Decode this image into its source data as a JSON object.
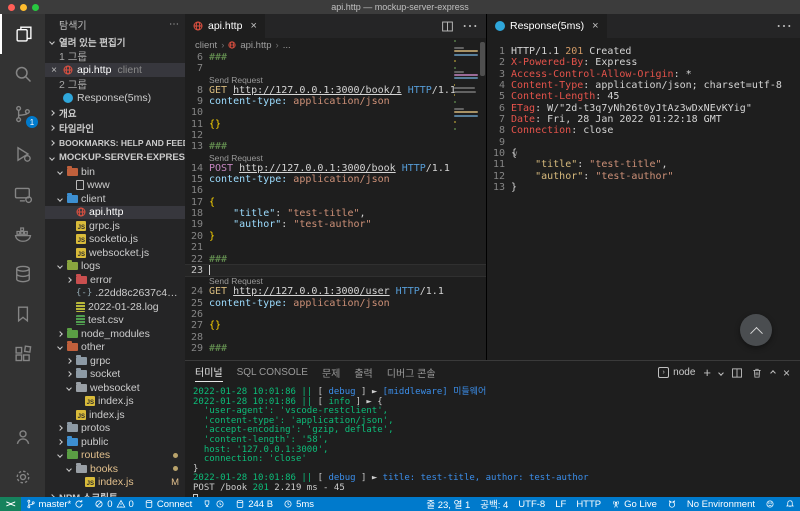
{
  "colors": {
    "accent": "#007acc",
    "remote_green": "#16825d",
    "titlebar": "#3c3c3c",
    "activity_bar": "#333333",
    "sidebar": "#252526",
    "editor_bg": "#1e1e1e",
    "git_modified": "#e2c08d",
    "http_icon": "#e25141",
    "response_icon": "#2fa7db"
  },
  "window": {
    "title": "api.http — mockup-server-express"
  },
  "activity_bar": {
    "scm_badge": "1"
  },
  "sidebar": {
    "title": "탐색기",
    "more": "⋯",
    "open_editors": "열려 있는 편집기",
    "group1": "1 그룹",
    "group2": "2 그룹",
    "editor1": "api.http",
    "editor1_detail": "client",
    "editor2": "Response(5ms)",
    "sections": {
      "outline": "개요",
      "timeline": "타임라인",
      "bookmarks": "BOOKMARKS: HELP AND FEEDBACK"
    },
    "project": "MOCKUP-SERVER-EXPRESS",
    "npm_scripts": "NPM 스크립트",
    "tree": [
      {
        "label": "bin",
        "indent": 1,
        "chev": "d",
        "icon": "folder",
        "color": "#c0603c"
      },
      {
        "label": "www",
        "indent": 2,
        "icon": "file"
      },
      {
        "label": "client",
        "indent": 1,
        "chev": "d",
        "icon": "folder",
        "color": "#3d8fd1"
      },
      {
        "label": "api.http",
        "indent": 2,
        "icon": "globe",
        "selected": true
      },
      {
        "label": "grpc.js",
        "indent": 2,
        "icon": "js"
      },
      {
        "label": "socketio.js",
        "indent": 2,
        "icon": "js"
      },
      {
        "label": "websocket.js",
        "indent": 2,
        "icon": "js"
      },
      {
        "label": "logs",
        "indent": 1,
        "chev": "d",
        "icon": "folder",
        "color": "#8aa53f"
      },
      {
        "label": "error",
        "indent": 2,
        "chev": "r",
        "icon": "folder",
        "color": "#c94f4f"
      },
      {
        "label": ".22dd8c2637c48183c5bb89...",
        "indent": 2,
        "icon": "json"
      },
      {
        "label": "2022-01-28.log",
        "indent": 2,
        "icon": "log"
      },
      {
        "label": "test.csv",
        "indent": 2,
        "icon": "csv"
      },
      {
        "label": "node_modules",
        "indent": 1,
        "chev": "r",
        "icon": "folder",
        "color": "#5a9e44"
      },
      {
        "label": "other",
        "indent": 1,
        "chev": "d",
        "icon": "folder",
        "color": "#c0603c"
      },
      {
        "label": "grpc",
        "indent": 2,
        "chev": "r",
        "icon": "folder",
        "color": "#8d9aa5"
      },
      {
        "label": "socket",
        "indent": 2,
        "chev": "r",
        "icon": "folder",
        "color": "#8d9aa5"
      },
      {
        "label": "websocket",
        "indent": 2,
        "chev": "d",
        "icon": "folder",
        "color": "#9aa0a6"
      },
      {
        "label": "index.js",
        "indent": 3,
        "icon": "js"
      },
      {
        "label": "index.js",
        "indent": 2,
        "icon": "js"
      },
      {
        "label": "protos",
        "indent": 1,
        "chev": "r",
        "icon": "folder",
        "color": "#8d9aa5"
      },
      {
        "label": "public",
        "indent": 1,
        "chev": "r",
        "icon": "folder",
        "color": "#3d8fd1"
      },
      {
        "label": "routes",
        "indent": 1,
        "chev": "d",
        "icon": "folder",
        "color": "#5a9e44",
        "modified": true,
        "badge": "dot"
      },
      {
        "label": "books",
        "indent": 2,
        "chev": "d",
        "icon": "folder",
        "color": "#9aa0a6",
        "modified": true,
        "badge": "dot"
      },
      {
        "label": "index.js",
        "indent": 3,
        "icon": "js",
        "modified": true,
        "badge": "M"
      }
    ]
  },
  "editor": {
    "tab": "api.http",
    "breadcrumb": {
      "a": "client",
      "b": "api.http",
      "c": "..."
    },
    "codelens": "Send Request",
    "lines": [
      {
        "n": "6",
        "parts": [
          [
            "###",
            "cmt"
          ]
        ]
      },
      {
        "n": "7"
      },
      {
        "lens": true
      },
      {
        "n": "8",
        "parts": [
          [
            "GET ",
            "get"
          ],
          [
            "http://127.0.0.1:3000/book/1",
            "url"
          ],
          [
            " ",
            ""
          ],
          [
            "HTTP",
            "kw"
          ],
          [
            "/1.1",
            ""
          ]
        ]
      },
      {
        "n": "9",
        "parts": [
          [
            "content-type: ",
            "key"
          ],
          [
            "application/json",
            "val"
          ]
        ]
      },
      {
        "n": "10"
      },
      {
        "n": "11",
        "parts": [
          [
            "{}",
            "br"
          ]
        ]
      },
      {
        "n": "12"
      },
      {
        "n": "13",
        "parts": [
          [
            "###",
            "cmt"
          ]
        ]
      },
      {
        "lens": true
      },
      {
        "n": "14",
        "parts": [
          [
            "POST ",
            "post"
          ],
          [
            "http://127.0.0.1:3000/book",
            "url"
          ],
          [
            " ",
            ""
          ],
          [
            "HTTP",
            "kw"
          ],
          [
            "/1.1",
            ""
          ]
        ]
      },
      {
        "n": "15",
        "parts": [
          [
            "content-type: ",
            "key"
          ],
          [
            "application/json",
            "val"
          ]
        ]
      },
      {
        "n": "16"
      },
      {
        "n": "17",
        "parts": [
          [
            "{",
            "br"
          ]
        ]
      },
      {
        "n": "18",
        "parts": [
          [
            "    ",
            ""
          ],
          [
            "\"title\"",
            "key"
          ],
          [
            ": ",
            ""
          ],
          [
            "\"test-title\"",
            "val"
          ],
          [
            ",",
            ""
          ]
        ]
      },
      {
        "n": "19",
        "parts": [
          [
            "    ",
            ""
          ],
          [
            "\"author\"",
            "key"
          ],
          [
            ": ",
            ""
          ],
          [
            "\"test-author\"",
            "val"
          ]
        ]
      },
      {
        "n": "20",
        "parts": [
          [
            "}",
            "br"
          ]
        ]
      },
      {
        "n": "21"
      },
      {
        "n": "22",
        "parts": [
          [
            "###",
            "cmt"
          ]
        ]
      },
      {
        "n": "23",
        "cursor": true,
        "current": true
      },
      {
        "lens": true
      },
      {
        "n": "24",
        "parts": [
          [
            "GET ",
            "get"
          ],
          [
            "http://127.0.0.1:3000/user",
            "url"
          ],
          [
            " ",
            ""
          ],
          [
            "HTTP",
            "kw"
          ],
          [
            "/1.1",
            ""
          ]
        ]
      },
      {
        "n": "25",
        "parts": [
          [
            "content-type: ",
            "key"
          ],
          [
            "application/json",
            "val"
          ]
        ]
      },
      {
        "n": "26"
      },
      {
        "n": "27",
        "parts": [
          [
            "{}",
            "br"
          ]
        ]
      },
      {
        "n": "28"
      },
      {
        "n": "29",
        "parts": [
          [
            "###",
            "cmt"
          ]
        ]
      }
    ]
  },
  "response": {
    "tab": "Response(5ms)",
    "more": "⋯",
    "lines": [
      {
        "n": "1",
        "parts": [
          [
            "HTTP/1.1 ",
            ""
          ],
          [
            "201",
            "num"
          ],
          [
            " Created",
            ""
          ]
        ]
      },
      {
        "n": "2",
        "parts": [
          [
            "X-Powered-By",
            "hdr"
          ],
          [
            ": ",
            ""
          ],
          [
            "Express",
            ""
          ]
        ]
      },
      {
        "n": "3",
        "parts": [
          [
            "Access-Control-Allow-Origin",
            "hdr"
          ],
          [
            ": ",
            ""
          ],
          [
            "*",
            ""
          ]
        ]
      },
      {
        "n": "4",
        "parts": [
          [
            "Content-Type",
            "hdr"
          ],
          [
            ": ",
            ""
          ],
          [
            "application/json; charset=utf-8",
            ""
          ]
        ]
      },
      {
        "n": "5",
        "parts": [
          [
            "Content-Length",
            "hdr"
          ],
          [
            ": ",
            ""
          ],
          [
            "45",
            ""
          ]
        ]
      },
      {
        "n": "6",
        "parts": [
          [
            "ETag",
            "hdr"
          ],
          [
            ": ",
            ""
          ],
          [
            "W/\"2d-t3q7yNh26t0yJtAz3wDxNEvKYig\"",
            ""
          ]
        ]
      },
      {
        "n": "7",
        "parts": [
          [
            "Date",
            "hdr"
          ],
          [
            ": ",
            ""
          ],
          [
            "Fri, 28 Jan 2022 01:22:18 GMT",
            ""
          ]
        ]
      },
      {
        "n": "8",
        "parts": [
          [
            "Connection",
            "hdr"
          ],
          [
            ": ",
            ""
          ],
          [
            "close",
            ""
          ]
        ]
      },
      {
        "n": "9"
      },
      {
        "n": "10",
        "fold": true,
        "parts": [
          [
            "{",
            ""
          ]
        ]
      },
      {
        "n": "11",
        "parts": [
          [
            "    ",
            ""
          ],
          [
            "\"title\"",
            "rkey"
          ],
          [
            ": ",
            ""
          ],
          [
            "\"test-title\"",
            "val"
          ],
          [
            ",",
            ""
          ]
        ]
      },
      {
        "n": "12",
        "parts": [
          [
            "    ",
            ""
          ],
          [
            "\"author\"",
            "rkey"
          ],
          [
            ": ",
            ""
          ],
          [
            "\"test-author\"",
            "val"
          ]
        ]
      },
      {
        "n": "13",
        "parts": [
          [
            "}",
            ""
          ]
        ]
      }
    ]
  },
  "panel": {
    "tabs": [
      "터미널",
      "SQL CONSOLE",
      "문제",
      "출력",
      "디버그 콘솔"
    ],
    "active_tab": "터미널",
    "shell": "node",
    "lines": [
      {
        "parts": [
          [
            "2022-01-28 10:01:86 || ",
            "grn"
          ],
          [
            "[ ",
            "fg"
          ],
          [
            "debug",
            "blu"
          ],
          [
            " ] ",
            "fg"
          ],
          [
            "► ",
            "fg"
          ],
          [
            "[middleware] 미들웨어",
            "blu"
          ]
        ]
      },
      {
        "parts": [
          [
            "2022-01-28 10:01:86 || ",
            "grn"
          ],
          [
            "[ ",
            "fg"
          ],
          [
            "info",
            "grn"
          ],
          [
            " ] ",
            "fg"
          ],
          [
            "► ",
            "fg"
          ],
          [
            "{",
            "fg"
          ]
        ]
      },
      {
        "parts": [
          [
            "  'user-agent': 'vscode-restclient',",
            "grn"
          ]
        ]
      },
      {
        "parts": [
          [
            "  'content-type': 'application/json',",
            "grn"
          ]
        ]
      },
      {
        "parts": [
          [
            "  'accept-encoding': 'gzip, deflate',",
            "grn"
          ]
        ]
      },
      {
        "parts": [
          [
            "  'content-length': '58',",
            "grn"
          ]
        ]
      },
      {
        "parts": [
          [
            "  host: '127.0.0.1:3000',",
            "grn"
          ]
        ]
      },
      {
        "parts": [
          [
            "  connection: 'close'",
            "grn"
          ]
        ]
      },
      {
        "parts": [
          [
            "}",
            "fg"
          ]
        ]
      },
      {
        "parts": [
          [
            "2022-01-28 10:01:86 || ",
            "grn"
          ],
          [
            "[ ",
            "fg"
          ],
          [
            "debug",
            "blu"
          ],
          [
            " ] ",
            "fg"
          ],
          [
            "► ",
            "fg"
          ],
          [
            "title: test-title, author: test-author",
            "blu"
          ]
        ]
      },
      {
        "parts": [
          [
            "POST /book ",
            "fg"
          ],
          [
            "201",
            "grn"
          ],
          [
            " 2.219 ms - 45",
            "fg"
          ]
        ]
      },
      {
        "cursor": true
      }
    ]
  },
  "status_bar": {
    "remote": "><",
    "branch": "master*",
    "errors": "0",
    "warnings": "0",
    "connect": "Connect",
    "size": "244 B",
    "time": "5ms",
    "line_col": "줄 23, 열 1",
    "spaces": "공백: 4",
    "encoding": "UTF-8",
    "eol": "LF",
    "language": "HTTP",
    "go_live": "Go Live",
    "environment": "No Environment"
  }
}
